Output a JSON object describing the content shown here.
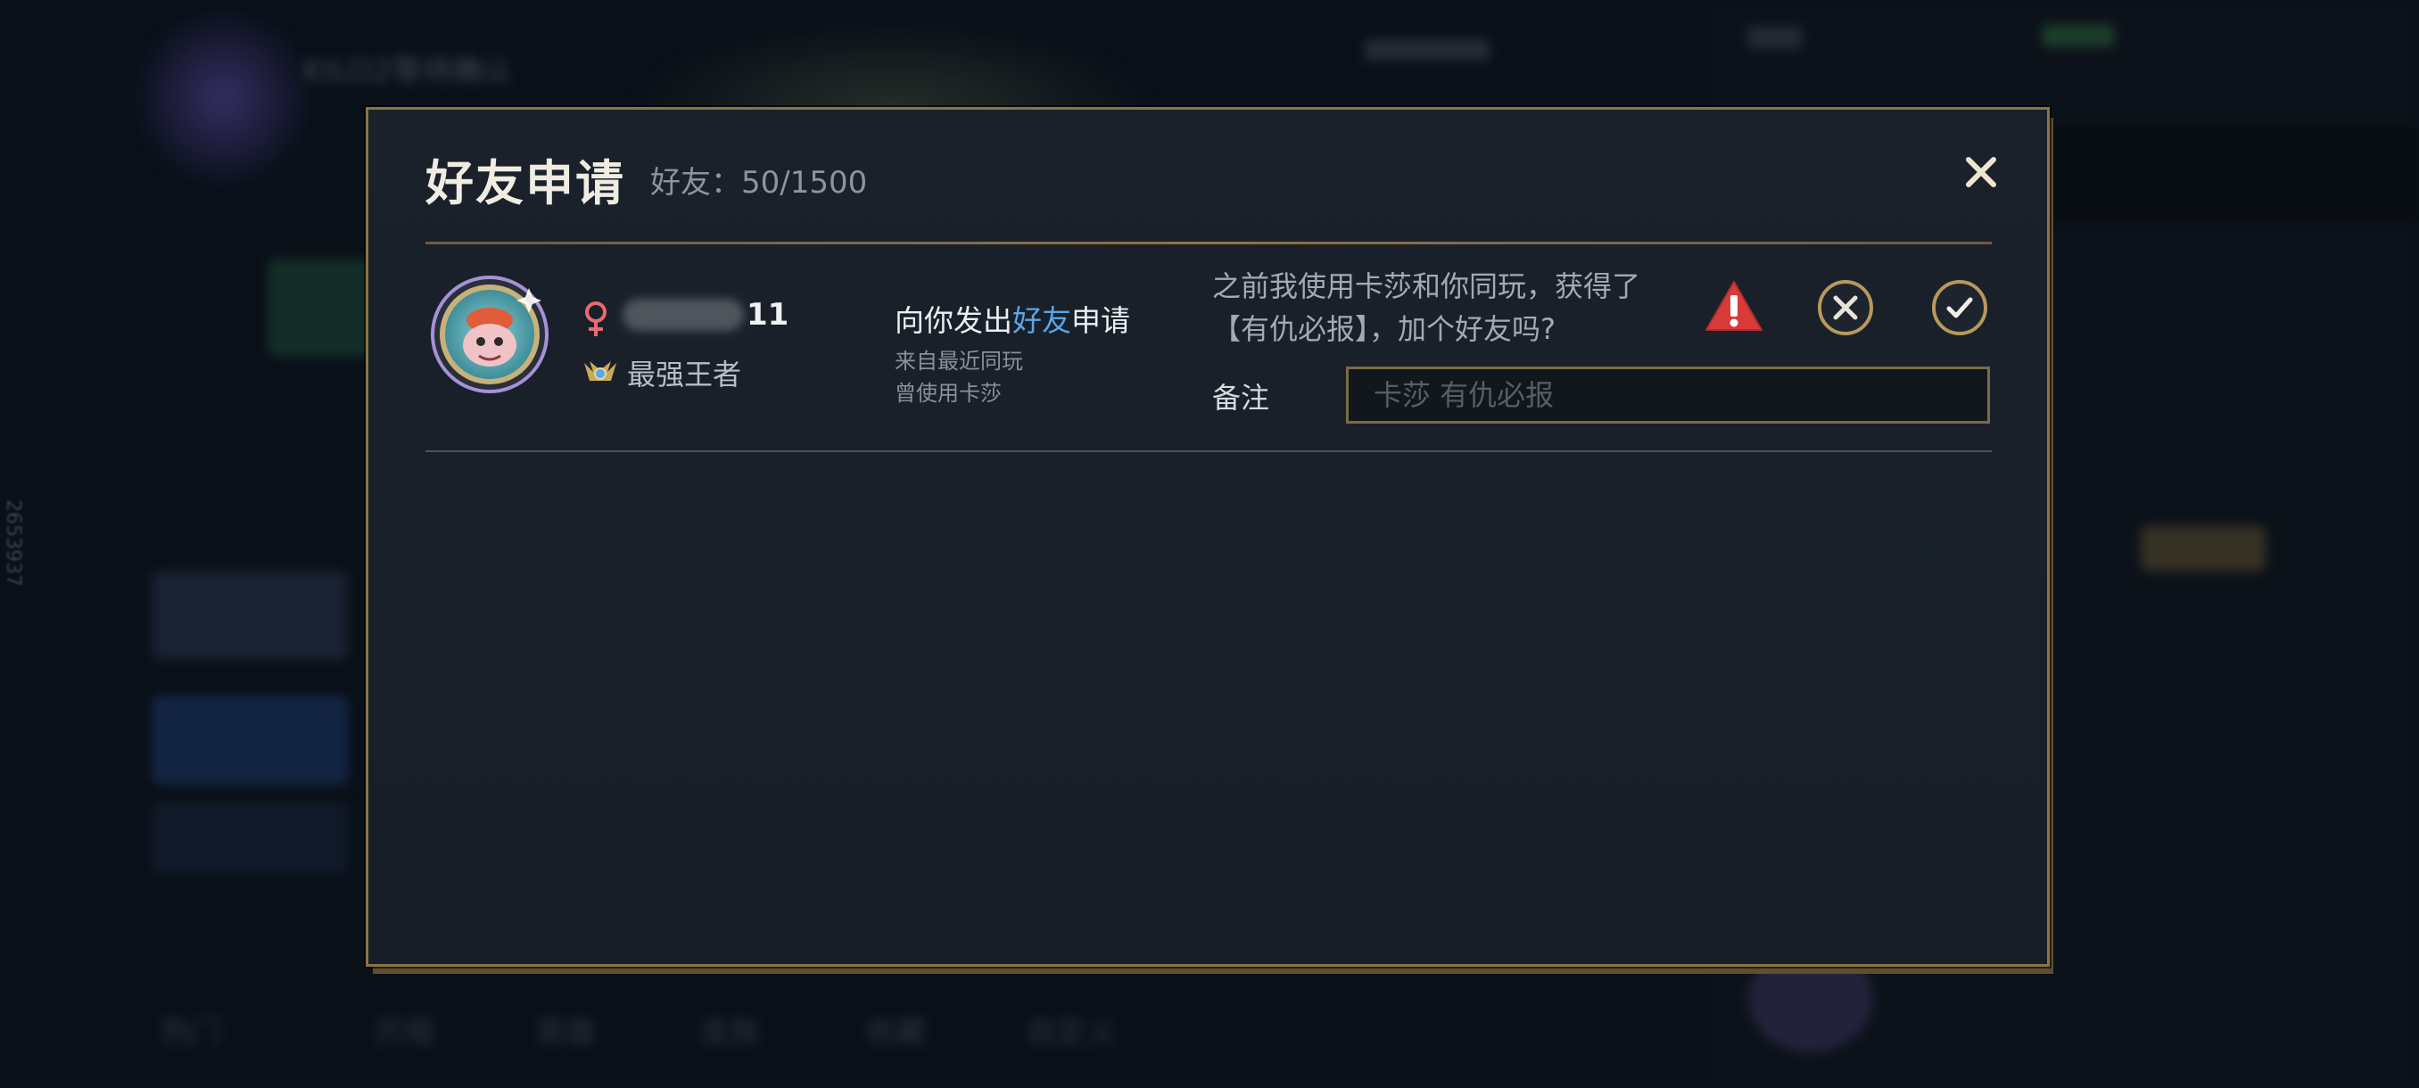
{
  "background": {
    "header_name": "KILO2等待确认",
    "side_id": "2653937",
    "nav_items": [
      "热门",
      "历程",
      "英雄",
      "皮肤",
      "收藏",
      "自定义"
    ]
  },
  "dialog": {
    "title": "好友申请",
    "friend_count": "好友：50/1500",
    "request": {
      "gender_icon": "female-icon",
      "name_suffix": "11",
      "rank": "最强王者",
      "action_prefix": "向你发出",
      "action_highlight": "好友",
      "action_suffix": "申请",
      "source": "来自最近同玩",
      "used_champion": "曾使用卡莎",
      "message": "之前我使用卡莎和你同玩，获得了【有仇必报】，加个好友吗?",
      "note_label": "备注",
      "note_placeholder": "卡莎 有仇必报"
    }
  },
  "colors": {
    "gold_border": "#8b7444",
    "highlight_blue": "#5aa6e6",
    "warning_red": "#d93a3a",
    "female_pink": "#e86a72"
  }
}
